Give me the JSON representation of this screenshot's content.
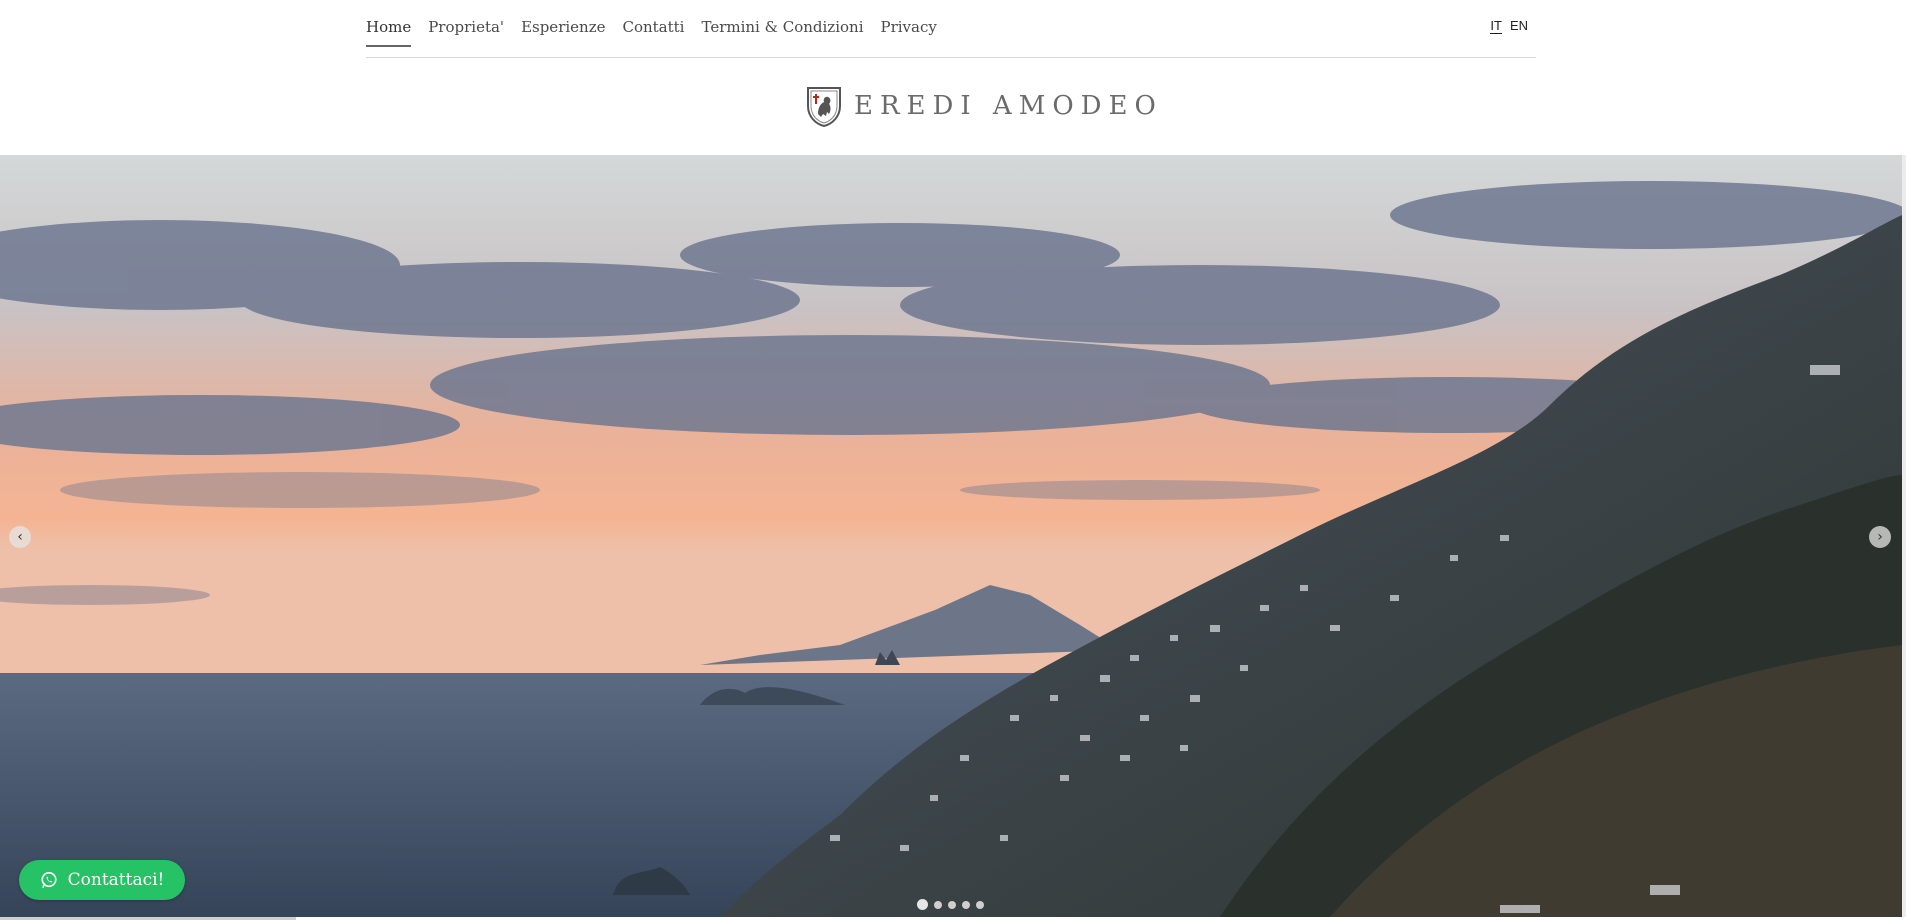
{
  "nav": {
    "items": [
      {
        "label": "Home",
        "active": true
      },
      {
        "label": "Proprieta'"
      },
      {
        "label": "Esperienze"
      },
      {
        "label": "Contatti"
      },
      {
        "label": "Termini & Condizioni"
      },
      {
        "label": "Privacy"
      }
    ],
    "languages": [
      {
        "label": "IT",
        "active": true
      },
      {
        "label": "EN"
      }
    ]
  },
  "brand": {
    "name": "EREDI AMODEO",
    "logo_icon": "crest-lion-icon"
  },
  "slider": {
    "prev_icon": "chevron-left-icon",
    "next_icon": "chevron-right-icon",
    "prev_glyph": "‹",
    "next_glyph": "›",
    "slide_count": 5,
    "active_slide": 1
  },
  "contact_button": {
    "label": "Contattaci!",
    "icon": "whatsapp-icon",
    "color": "#25c266"
  }
}
